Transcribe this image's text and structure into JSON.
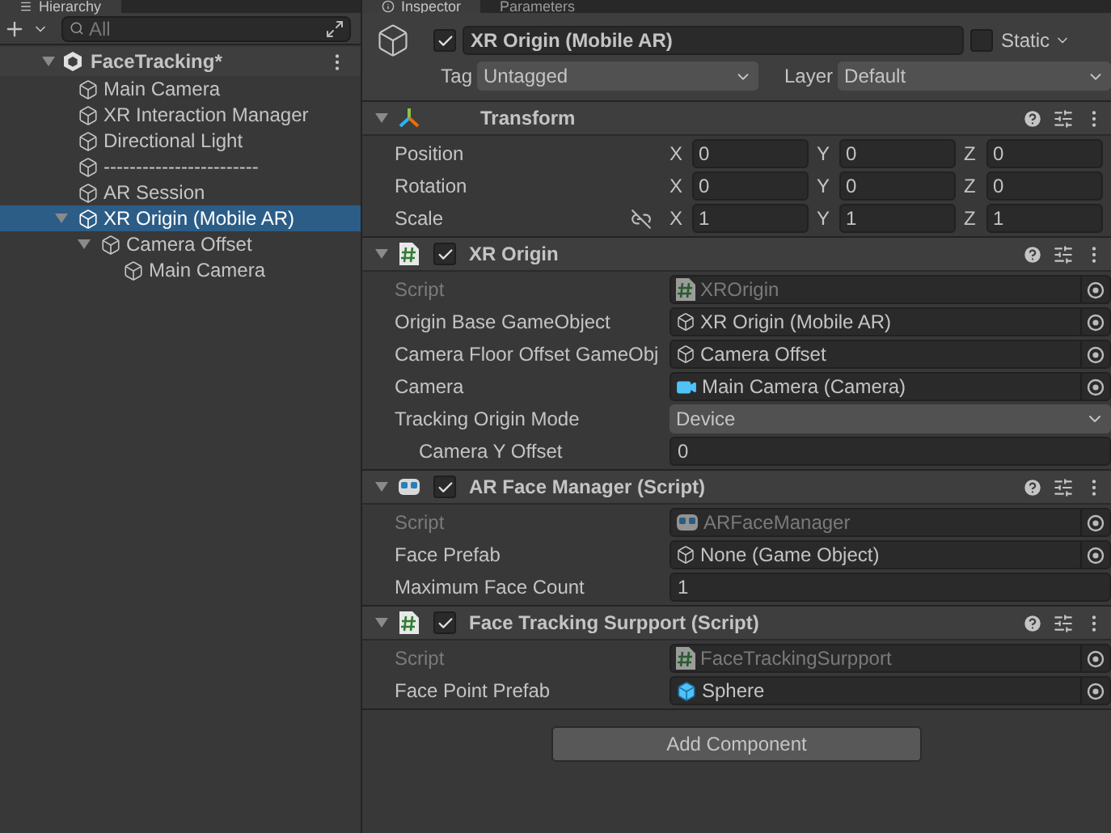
{
  "hierarchy": {
    "tab": {
      "label": "Hierarchy",
      "selected": true
    },
    "search": {
      "placeholder": "All"
    },
    "scene": {
      "name": "FaceTracking*",
      "expanded": true,
      "children": [
        {
          "name": "Main Camera",
          "selected": false
        },
        {
          "name": "XR Interaction Manager",
          "selected": false
        },
        {
          "name": "Directional Light",
          "selected": false
        },
        {
          "name": "------------------------",
          "selected": false
        },
        {
          "name": "AR Session",
          "selected": false
        },
        {
          "name": "XR Origin (Mobile AR)",
          "selected": true,
          "expanded": true,
          "children": [
            {
              "name": "Camera Offset",
              "selected": false,
              "expanded": true,
              "children": [
                {
                  "name": "Main Camera",
                  "selected": false
                }
              ]
            }
          ]
        }
      ]
    }
  },
  "inspector": {
    "tabs": [
      {
        "label": "Inspector",
        "selected": true
      },
      {
        "label": "Parameters",
        "selected": false
      }
    ],
    "object": {
      "active": true,
      "name": "XR Origin (Mobile AR)",
      "static_label": "Static",
      "static": false,
      "tag_label": "Tag",
      "tag": "Untagged",
      "layer_label": "Layer",
      "layer": "Default"
    },
    "components": [
      {
        "kind": "transform",
        "title": "Transform",
        "expanded": true,
        "rows": [
          {
            "label": "Position",
            "constrained": false,
            "values": [
              {
                "axis": "X",
                "value": "0"
              },
              {
                "axis": "Y",
                "value": "0"
              },
              {
                "axis": "Z",
                "value": "0"
              }
            ]
          },
          {
            "label": "Rotation",
            "constrained": false,
            "values": [
              {
                "axis": "X",
                "value": "0"
              },
              {
                "axis": "Y",
                "value": "0"
              },
              {
                "axis": "Z",
                "value": "0"
              }
            ]
          },
          {
            "label": "Scale",
            "constrained": true,
            "values": [
              {
                "axis": "X",
                "value": "1"
              },
              {
                "axis": "Y",
                "value": "1"
              },
              {
                "axis": "Z",
                "value": "1"
              }
            ]
          }
        ]
      },
      {
        "kind": "script",
        "title": "XR Origin",
        "enabled": true,
        "expanded": true,
        "fields": [
          {
            "kind": "script",
            "label": "Script",
            "value": "XROrigin",
            "disabled": true
          },
          {
            "kind": "object",
            "label": "Origin Base GameObject",
            "value": "XR Origin (Mobile AR)"
          },
          {
            "kind": "object",
            "label": "Camera Floor Offset GameObj",
            "value": "Camera Offset"
          },
          {
            "kind": "camera",
            "label": "Camera",
            "value": "Main Camera (Camera)"
          },
          {
            "kind": "dropdown",
            "label": "Tracking Origin Mode",
            "value": "Device",
            "children": [
              {
                "kind": "text",
                "label": "Camera Y Offset",
                "value": "0"
              }
            ]
          }
        ]
      },
      {
        "kind": "ar_script",
        "title": "AR Face Manager (Script)",
        "enabled": true,
        "expanded": true,
        "fields": [
          {
            "kind": "ar_script",
            "label": "Script",
            "value": "ARFaceManager",
            "disabled": true
          },
          {
            "kind": "object",
            "label": "Face Prefab",
            "value": "None (Game Object)"
          },
          {
            "kind": "text",
            "label": "Maximum Face Count",
            "value": "1"
          }
        ]
      },
      {
        "kind": "script",
        "title": "Face Tracking Surpport (Script)",
        "enabled": true,
        "expanded": true,
        "fields": [
          {
            "kind": "script",
            "label": "Script",
            "value": "FaceTrackingSurpport",
            "disabled": true
          },
          {
            "kind": "prefab",
            "label": "Face Point Prefab",
            "value": "Sphere"
          }
        ]
      }
    ],
    "add_button": "Add Component"
  }
}
